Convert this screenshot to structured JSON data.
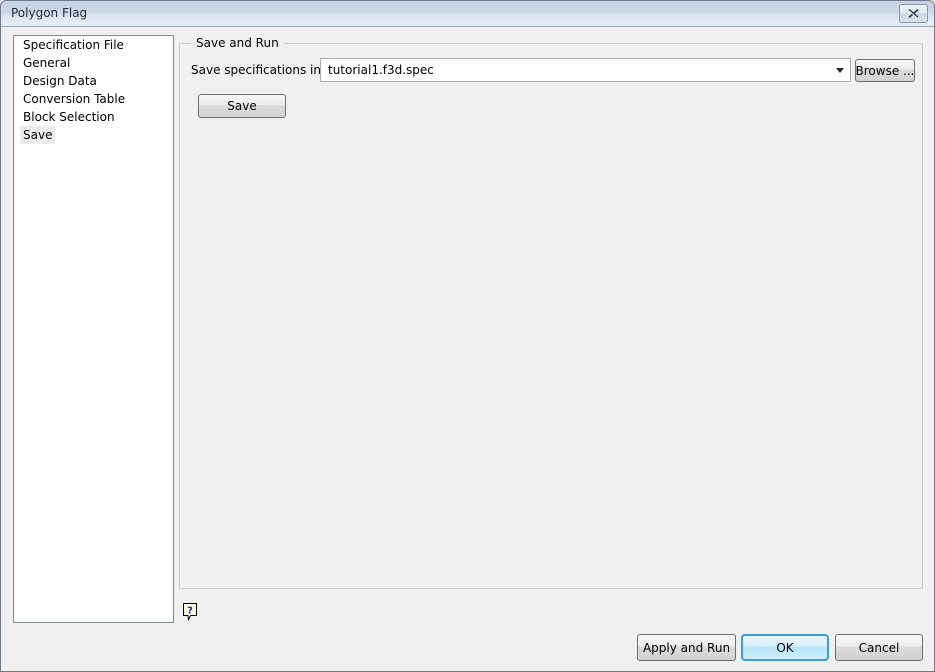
{
  "window": {
    "title": "Polygon Flag",
    "close_icon": "close-icon"
  },
  "sidebar": {
    "items": [
      {
        "label": "Specification File",
        "selected": false
      },
      {
        "label": "General",
        "selected": false
      },
      {
        "label": "Design Data",
        "selected": false
      },
      {
        "label": "Conversion Table",
        "selected": false
      },
      {
        "label": "Block Selection",
        "selected": false
      },
      {
        "label": "Save",
        "selected": true
      }
    ]
  },
  "main": {
    "group_title": "Save and Run",
    "field_label": "Save specifications into",
    "spec_file": {
      "value": "tutorial1.f3d.spec",
      "placeholder": "",
      "dropdown_icon": "chevron-down-icon"
    },
    "browse_label": "Browse ...",
    "save_label": "Save",
    "help_icon": "help-question-icon"
  },
  "footer": {
    "apply_and_run_label": "Apply and Run",
    "ok_label": "OK",
    "cancel_label": "Cancel"
  },
  "colors": {
    "window_background": "#f0f0f0",
    "titlebar_top": "#c5d1df",
    "titlebar_bottom": "#e9f0f7",
    "default_button_border": "#3c9ade",
    "list_background": "#ffffff",
    "selection_background": "#ececec"
  }
}
